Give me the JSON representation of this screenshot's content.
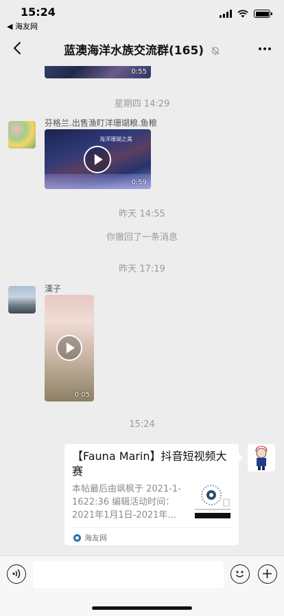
{
  "status_bar": {
    "time": "15:24",
    "back_app": "◀ 海友网"
  },
  "nav": {
    "title": "蓝澳海洋水族交流群(165)",
    "back_icon": "chevron-left-icon",
    "more_icon": "more-icon",
    "muted": true
  },
  "messages": {
    "video_top": {
      "duration": "0:55"
    },
    "timestamp_1": "星期四 14:29",
    "msg_2": {
      "sender": "芬格兰.出售渔盯洋珊瑚粮.鱼粮",
      "duration": "0:59",
      "overlay_text": "海洋珊瑚之美"
    },
    "timestamp_2": "昨天 14:55",
    "recall_notice": "你撤回了一条消息",
    "timestamp_3": "昨天 17:19",
    "msg_3": {
      "sender": "漢子",
      "duration": "0:05"
    },
    "timestamp_4": "15:24",
    "link_card": {
      "title": "【Fauna Marin】抖音短视频大赛",
      "description": "本帖最后由飒枫于 2021-1-1622:36 编辑活动时间：2021年1月1日-2021年…",
      "source": "海友网"
    }
  },
  "input_bar": {
    "placeholder": "",
    "voice_icon": "voice-icon",
    "emoji_icon": "emoji-icon",
    "plus_icon": "plus-icon"
  },
  "colors": {
    "background": "#ededed",
    "card": "#ffffff",
    "timestamp": "#9a9a9a"
  }
}
